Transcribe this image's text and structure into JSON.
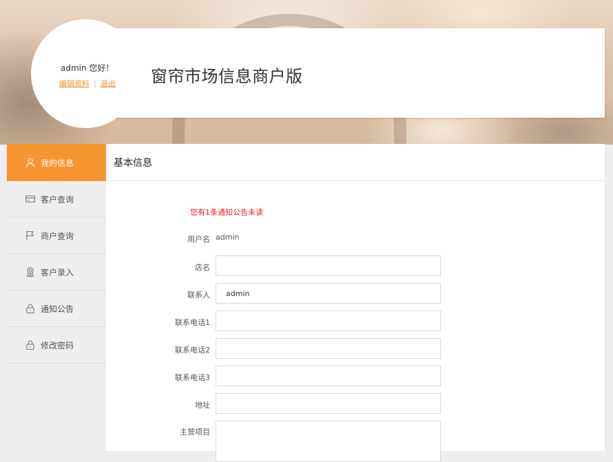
{
  "user": {
    "greeting": "admin 您好！",
    "edit_profile_label": "编辑资料",
    "separator": "|",
    "logout_label": "退出"
  },
  "site": {
    "title": "窗帘市场信息商户版"
  },
  "sidebar": {
    "items": [
      {
        "label": "我的信息",
        "icon": "user-icon",
        "active": true
      },
      {
        "label": "客户查询",
        "icon": "card-icon",
        "active": false
      },
      {
        "label": "商户查询",
        "icon": "flag-icon",
        "active": false
      },
      {
        "label": "客户录入",
        "icon": "badge-icon",
        "active": false
      },
      {
        "label": "通知公告",
        "icon": "lock-icon",
        "active": false
      },
      {
        "label": "修改密码",
        "icon": "lock-icon",
        "active": false
      }
    ]
  },
  "main": {
    "title": "基本信息",
    "notice": "您有1条通知公告未读",
    "form": {
      "username_label": "用户名",
      "username_value": "admin",
      "shop_label": "店名",
      "shop_value": "",
      "contact_label": "联系人",
      "contact_value": "admin",
      "phone1_label": "联系电话1",
      "phone1_value": "",
      "phone2_label": "联系电话2",
      "phone2_value": "",
      "phone3_label": "联系电话3",
      "phone3_value": "",
      "address_label": "地址",
      "address_value": "",
      "business_label": "主营项目",
      "business_value": ""
    }
  },
  "colors": {
    "accent": "#f7962f",
    "notice": "#e8221c",
    "link": "#f29127"
  }
}
